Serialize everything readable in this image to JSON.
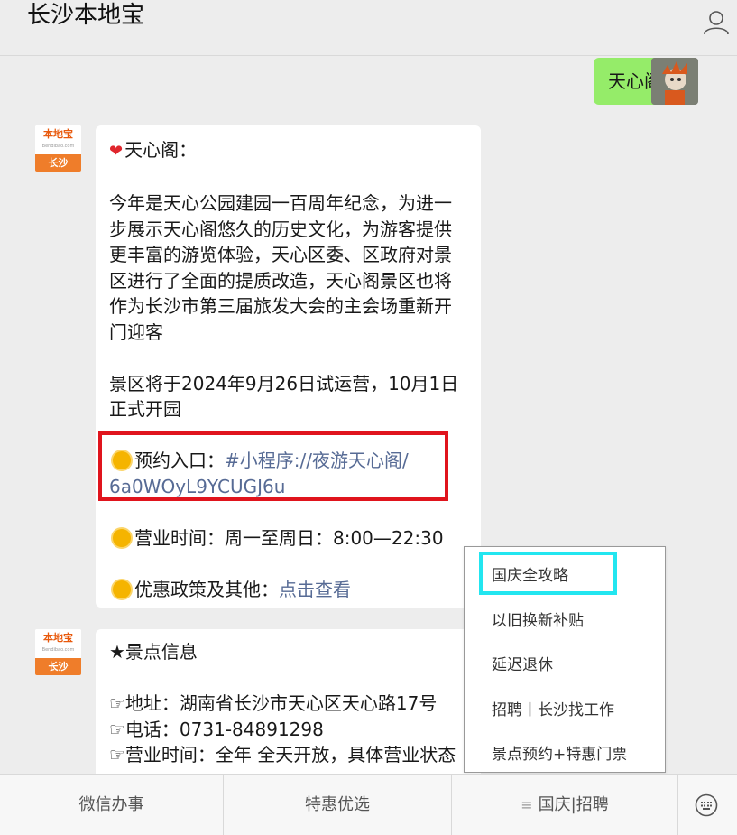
{
  "header": {
    "title": "长沙本地宝",
    "profile_icon": "person-icon"
  },
  "outgoing": {
    "text": "天心阁"
  },
  "avatar": {
    "brand": "本地宝",
    "url": "Bendibao.com",
    "city": "长沙"
  },
  "message1": {
    "title": "天心阁：",
    "para1": [
      "今年是天心公园建园一百周年纪念，为进一",
      "步展示天心阁悠久的历史文化，为游客提供",
      "更丰富的游览体验，天心区委、区政府对景",
      "区进行了全面的提质改造，天心阁景区也将",
      "作为长沙市第三届旅发大会的主会场重新开",
      "门迎客"
    ],
    "para2": [
      "景区将于2024年9月26日试运营，10月1日",
      "正式开园"
    ],
    "reserve_label": "预约入口：",
    "reserve_link_1": "#小程序://夜游天心阁/",
    "reserve_link_2": "6a0WOyL9YCUGJ6u",
    "hours": "营业时间：周一至周日：8:00—22:30",
    "policy_label": "优惠政策及其他：",
    "policy_link": "点击查看"
  },
  "message2": {
    "title": "★景点信息",
    "address": "☞地址：湖南省长沙市天心区天心路17号",
    "phone": "☞电话：0731-84891298",
    "hours": "☞营业时间：全年 全天开放，具体营业状态"
  },
  "menu": {
    "items": [
      "国庆全攻略",
      "以旧换新补贴",
      "延迟退休",
      "招聘丨长沙找工作",
      "景点预约+特惠门票"
    ]
  },
  "bottom_bar": {
    "tabs": [
      "微信办事",
      "特惠优选",
      "国庆|招聘"
    ],
    "keyboard_icon": "keyboard-icon",
    "menu_icon": "hamburger-icon"
  },
  "colors": {
    "accent_green": "#95ec69",
    "link": "#576b95",
    "highlight_red": "#e0141d",
    "highlight_cyan": "#22e6f0"
  }
}
